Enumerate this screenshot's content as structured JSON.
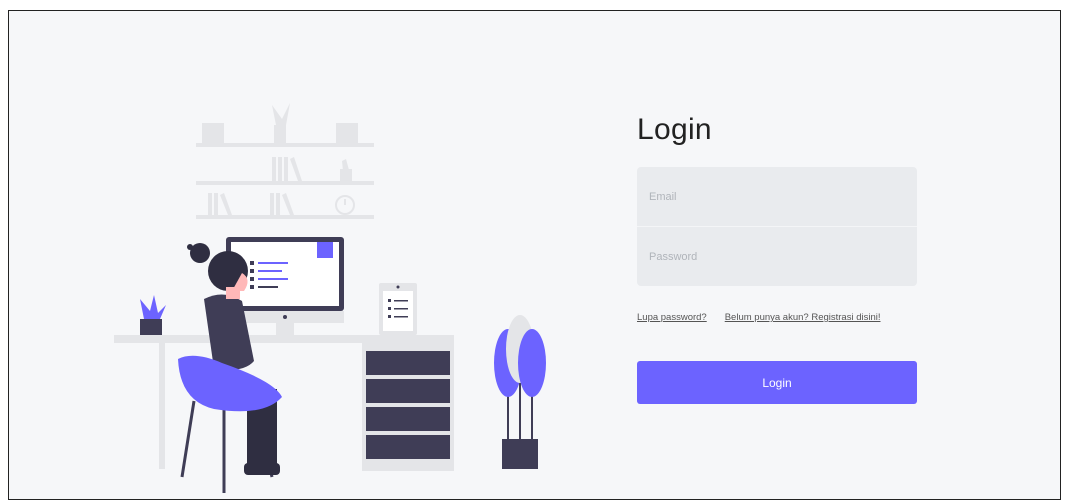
{
  "login": {
    "title": "Login",
    "email_placeholder": "Email",
    "password_placeholder": "Password",
    "forgot_link": "Lupa password?",
    "register_link": "Belum punya akun? Registrasi disini!",
    "button_label": "Login"
  },
  "colors": {
    "accent": "#6c63ff",
    "background": "#f6f7f9",
    "field_bg": "#e9ebee",
    "dark": "#3f3d56"
  },
  "illustration": {
    "description_icon": "woman-working-at-desk-illustration"
  }
}
